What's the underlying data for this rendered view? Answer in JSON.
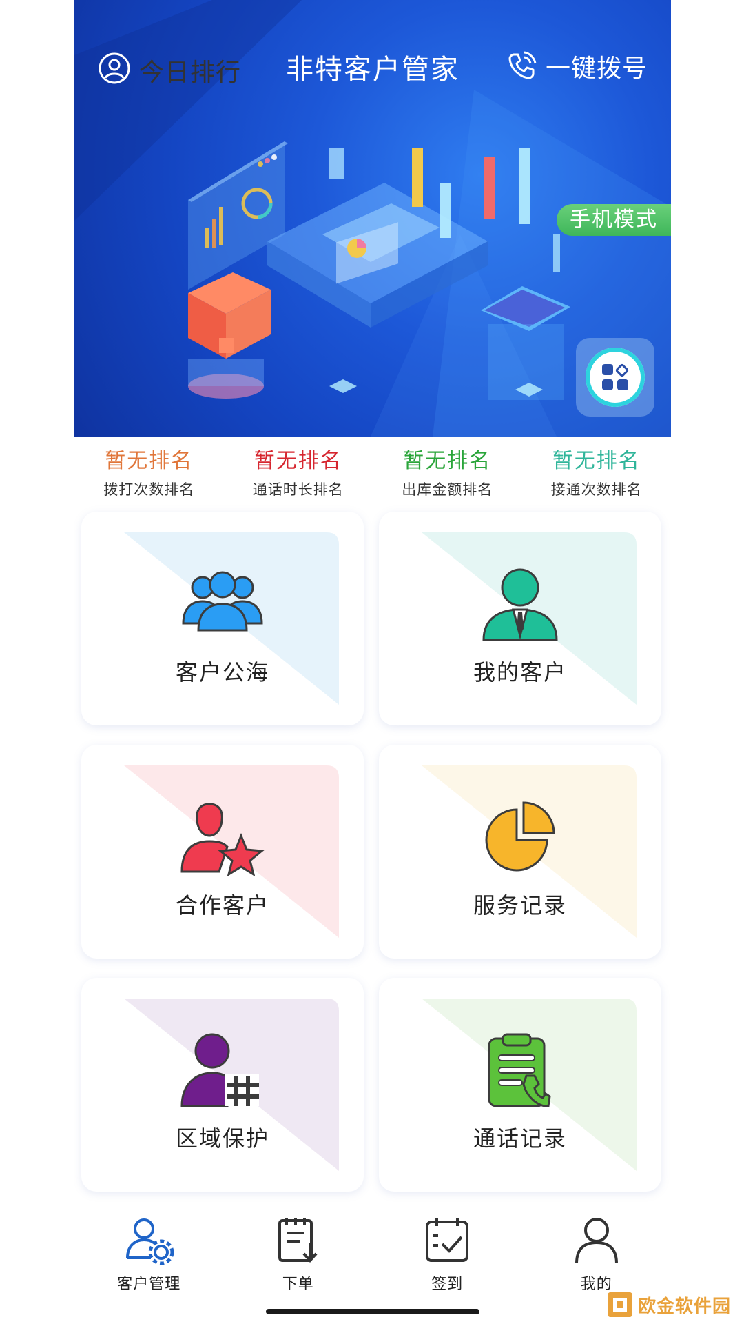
{
  "header": {
    "left_label": "今日排行",
    "title": "非特客户管家",
    "right_label": "一键拨号",
    "mode_tag": "手机模式"
  },
  "rankings": [
    {
      "value": "暂无排名",
      "label": "拨打次数排名",
      "color": "#e0763a"
    },
    {
      "value": "暂无排名",
      "label": "通话时长排名",
      "color": "#d6262f"
    },
    {
      "value": "暂无排名",
      "label": "出库金额排名",
      "color": "#2aa53a"
    },
    {
      "value": "暂无排名",
      "label": "接通次数排名",
      "color": "#2fb59a"
    }
  ],
  "cards": [
    {
      "label": "客户公海",
      "icon": "users-group-icon",
      "tint": "#e6f3fb"
    },
    {
      "label": "我的客户",
      "icon": "business-person-icon",
      "tint": "#e5f6f4"
    },
    {
      "label": "合作客户",
      "icon": "user-star-icon",
      "tint": "#fde8ea"
    },
    {
      "label": "服务记录",
      "icon": "pie-chart-icon",
      "tint": "#fdf7e8"
    },
    {
      "label": "区域保护",
      "icon": "user-hash-icon",
      "tint": "#efe8f3"
    },
    {
      "label": "通话记录",
      "icon": "clipboard-phone-icon",
      "tint": "#edf7ea"
    }
  ],
  "nav": [
    {
      "label": "客户管理",
      "icon": "user-settings-icon",
      "active": true
    },
    {
      "label": "下单",
      "icon": "order-icon",
      "active": false
    },
    {
      "label": "签到",
      "icon": "checkin-calendar-icon",
      "active": false
    },
    {
      "label": "我的",
      "icon": "profile-icon",
      "active": false
    }
  ],
  "watermark": "欧金软件园",
  "colors": {
    "banner_blue": "#1d58d8",
    "nav_active": "#1f64c8",
    "mode_tag_green": "#4cbd62"
  }
}
